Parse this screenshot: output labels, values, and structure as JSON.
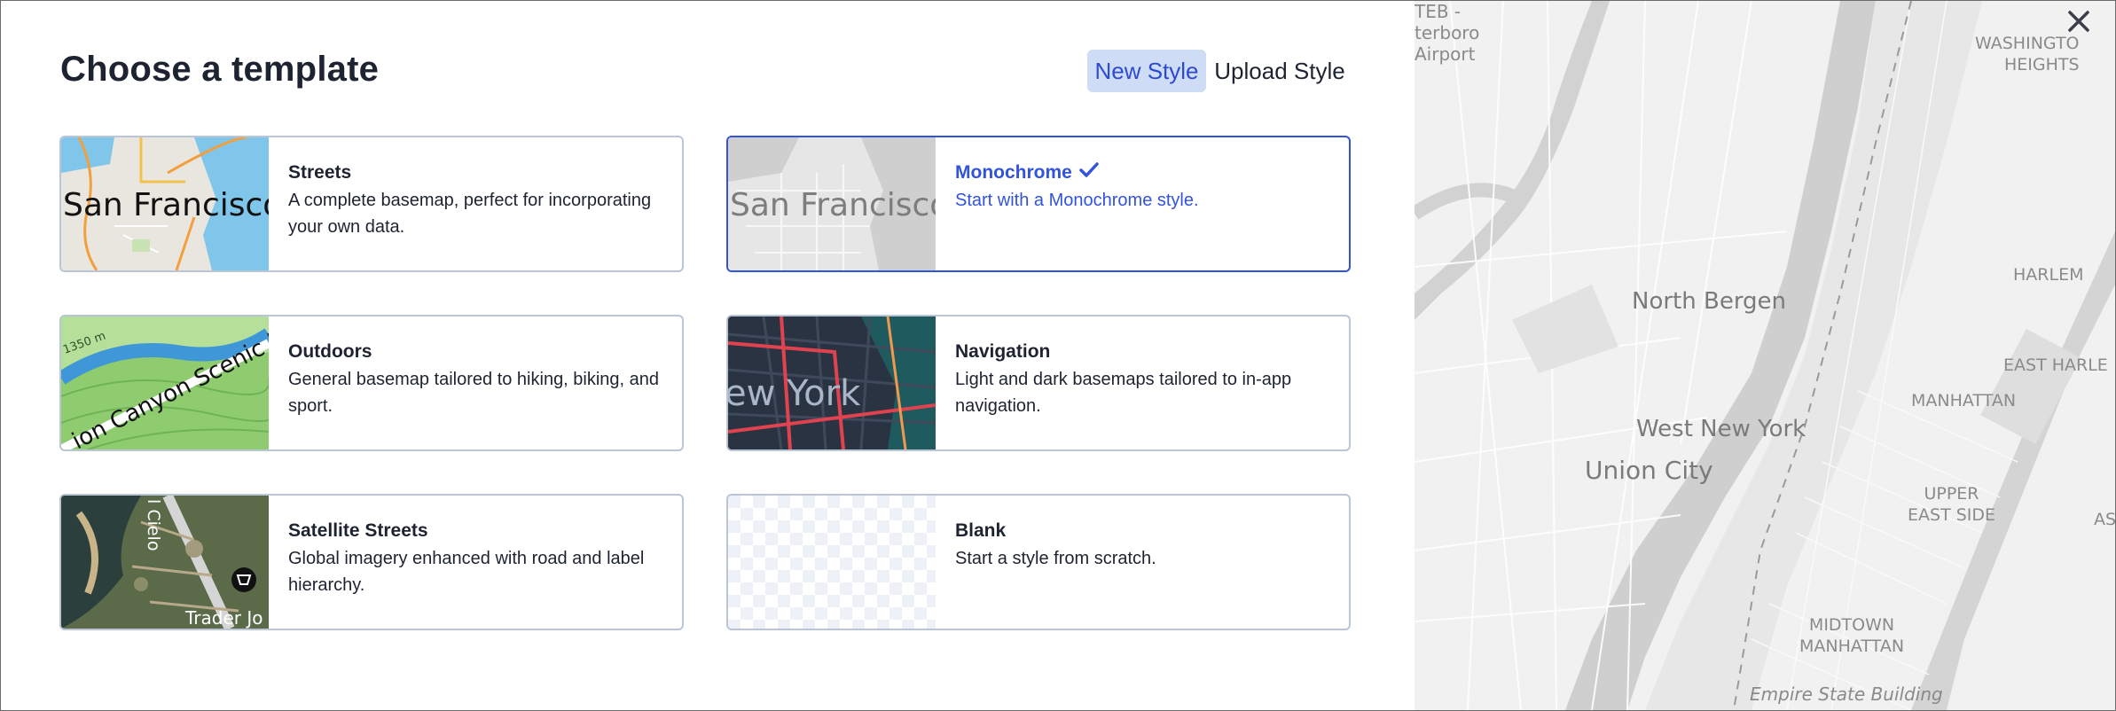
{
  "header": {
    "title": "Choose a template",
    "new_style_label": "New Style",
    "upload_style_label": "Upload Style"
  },
  "templates": [
    {
      "title": "Streets",
      "description": "A complete basemap, perfect for incorporating your own data.",
      "thumb_text": "San Francisco",
      "selected": false
    },
    {
      "title": "Monochrome",
      "description": "Start with a Monochrome style.",
      "thumb_text": "San Francisco",
      "selected": true
    },
    {
      "title": "Outdoors",
      "description": "General basemap tailored to hiking, biking, and sport.",
      "thumb_text": "ion Canyon Scenic Dr",
      "thumb_text_2": "1350 m",
      "selected": false
    },
    {
      "title": "Navigation",
      "description": "Light and dark basemaps tailored to in-app navigation.",
      "thumb_text": "ew York",
      "selected": false
    },
    {
      "title": "Satellite Streets",
      "description": "Global imagery enhanced with road and label hierarchy.",
      "thumb_text": "Trader Jo",
      "thumb_text_2": "l Cielo",
      "selected": false
    },
    {
      "title": "Blank",
      "description": "Start a style from scratch.",
      "selected": false
    }
  ],
  "map": {
    "labels": {
      "teterboro": "TEB -\nterboro\nAirport",
      "washington_heights": "WASHINGTO\nHEIGHTS",
      "north_bergen": "North Bergen",
      "harlem": "HARLEM",
      "east_harlem": "EAST HARLE",
      "manhattan": "MANHATTAN",
      "west_new_york": "West New York",
      "union_city": "Union City",
      "upper_east_side": "UPPER\nEAST SIDE",
      "as": "AS",
      "midtown": "MIDTOWN\nMANHATTAN",
      "empire_state": "Empire State Building"
    }
  },
  "colors": {
    "accent": "#3253db",
    "toggle_active_bg": "#cfdcf5",
    "card_border": "#b9c6d8"
  },
  "icons": {
    "close": "close-icon",
    "check": "check-icon"
  }
}
